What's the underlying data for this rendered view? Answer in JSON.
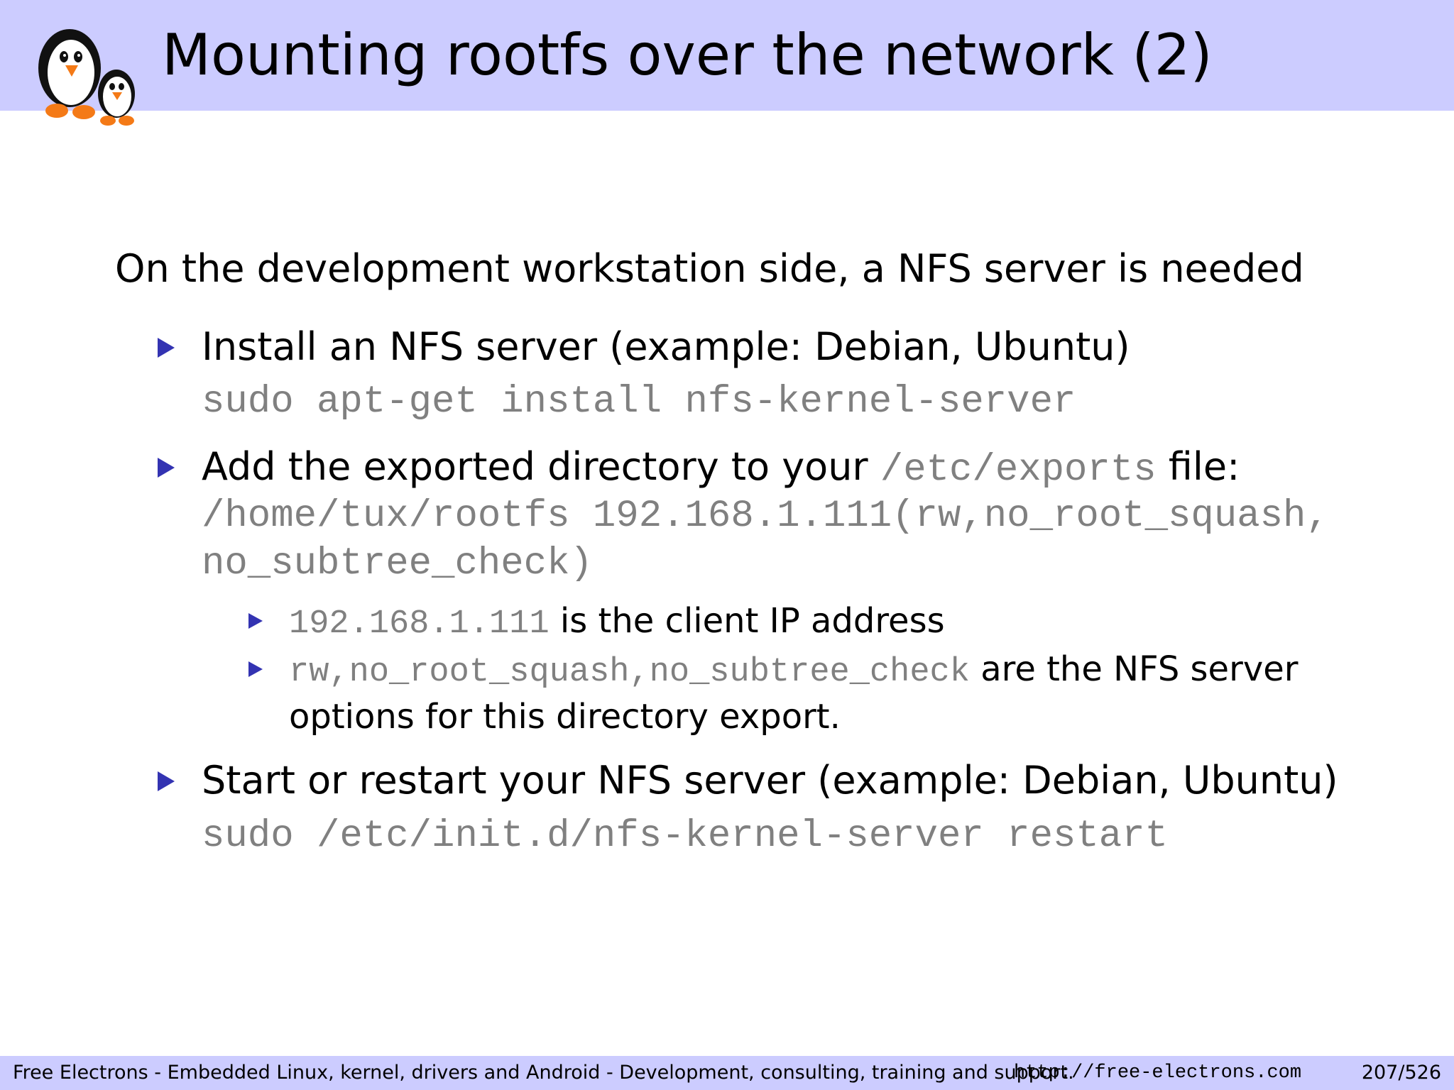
{
  "slide": {
    "title": "Mounting rootfs over the network (2)",
    "intro": "On the development workstation side, a NFS server is needed",
    "items": [
      {
        "text": "Install an NFS server (example: Debian, Ubuntu)",
        "code": "sudo apt-get install nfs-kernel-server"
      },
      {
        "text_before": "Add the exported directory to your ",
        "path": "/etc/exports",
        "text_after": " file:",
        "code_line1": "/home/tux/rootfs 192.168.1.111(rw,no_root_squash,",
        "code_line2": "no_subtree_check)",
        "subitems": [
          {
            "code": "192.168.1.111",
            "text": " is the client IP address"
          },
          {
            "code": "rw,no_root_squash,no_subtree_check",
            "text": " are the NFS server",
            "continuation": "options for this directory export."
          }
        ]
      },
      {
        "text": "Start or restart your NFS server (example: Debian, Ubuntu)",
        "code": "sudo /etc/init.d/nfs-kernel-server restart"
      }
    ]
  },
  "footer": {
    "text": "Free Electrons - Embedded Linux, kernel, drivers and Android - Development, consulting, training and support.",
    "url": "http://free-electrons.com",
    "page": "207/526"
  },
  "logo": {
    "icon": "penguins-logo-icon"
  },
  "colors": {
    "header_bg": "#ccccff",
    "bullet": "#3333b2",
    "code": "#808080"
  }
}
